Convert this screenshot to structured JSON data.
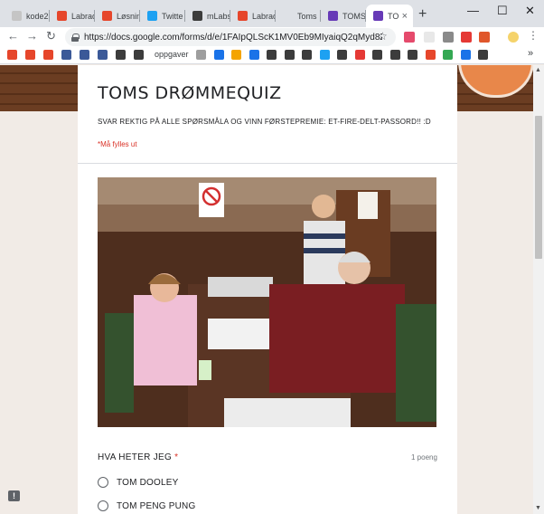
{
  "window": {
    "tabs": [
      {
        "label": "kode2",
        "favicon_color": "#c5c5c5",
        "active": false
      },
      {
        "label": "Labrad",
        "favicon_color": "#e6462b",
        "active": false
      },
      {
        "label": "Løsnin",
        "favicon_color": "#e6462b",
        "active": false
      },
      {
        "label": "Twitte",
        "favicon_color": "#1da1f2",
        "active": false
      },
      {
        "label": "mLabs",
        "favicon_color": "#3c3c3c",
        "active": false
      },
      {
        "label": "Labrad",
        "favicon_color": "#e6462b",
        "active": false
      },
      {
        "label": "Toms",
        "favicon_color": "#dee1e6",
        "active": false
      },
      {
        "label": "TOMS",
        "favicon_color": "#673ab7",
        "active": false
      },
      {
        "label": "TO",
        "favicon_color": "#673ab7",
        "active": true
      }
    ],
    "new_tab_label": "+",
    "minimize": "—",
    "maximize": "☐",
    "close": "✕"
  },
  "toolbar": {
    "back": "←",
    "forward": "→",
    "reload": "↻",
    "url": "https://docs.google.com/forms/d/e/1FAIpQLScK1MV0Eb9MIyaiqQ2qMyd8Zt...",
    "star": "☆",
    "extension_colors": [
      "#e54a6c",
      "#e8e8e8",
      "#8a8a8a",
      "#e53935",
      "#e0572b",
      "#e8c55a"
    ]
  },
  "bookmarks": {
    "icon_colors": [
      "#e6462b",
      "#e6462b",
      "#e6462b",
      "#3b5998",
      "#3b5998",
      "#3b5998",
      "#3c3c3c",
      "#3c3c3c",
      "#9e9e9e",
      "#1a73e8",
      "#f4a400",
      "#1a73e8",
      "#3c3c3c",
      "#3c3c3c",
      "#3c3c3c",
      "#1da1f2",
      "#3c3c3c",
      "#e53935",
      "#3c3c3c",
      "#3c3c3c",
      "#3c3c3c",
      "#e6462b",
      "#34a853",
      "#1a73e8",
      "#3c3c3c"
    ],
    "labeled": {
      "label": "oppgaver"
    },
    "more": "»"
  },
  "form": {
    "title": "TOMS DRØMMEQUIZ",
    "description": "SVAR REKTIG PÅ ALLE SPØRSMÅLA OG VINN FØRSTEPREMIE: ET-FIRE-DELT-PASSORD!! :D",
    "required_note": "*Må fylles ut",
    "question": {
      "title": "HVA HETER JEG",
      "required_mark": "*",
      "points": "1 poeng",
      "options": [
        {
          "label": "TOM DOOLEY"
        },
        {
          "label": "TOM PENG PUNG"
        }
      ]
    }
  },
  "feedback_icon": "!",
  "scroll_up": "▲",
  "scroll_down": "▼",
  "colors": {
    "accent": "#673ab7",
    "required": "#d93025",
    "page_bg": "#f1ebe6"
  }
}
